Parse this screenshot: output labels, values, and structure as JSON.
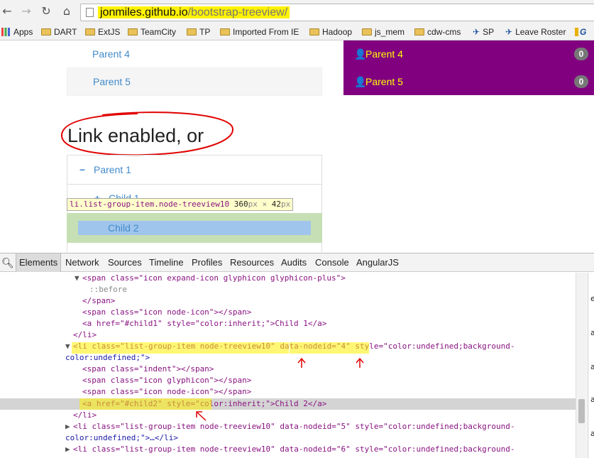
{
  "browser": {
    "url_host": "jonmiles.github.io",
    "url_path": "/bootstrap-treeview/"
  },
  "bookmarks": [
    "Apps",
    "DART",
    "ExtJS",
    "TeamCity",
    "TP",
    "Imported From IE",
    "Hadoop",
    "js_mem",
    "cdw-cms",
    "SP",
    "Leave Roster",
    "G"
  ],
  "left_tree": {
    "items": [
      "Parent 4",
      "Parent 5"
    ]
  },
  "purple_tree": {
    "items": [
      {
        "label": "Parent 4",
        "badge": "0"
      },
      {
        "label": "Parent 5",
        "badge": "0"
      }
    ]
  },
  "section_title": "Link enabled, or",
  "tree2": {
    "parent1": "Parent 1",
    "child1": "Child 1",
    "child2": "Child 2",
    "minus": "−"
  },
  "tooltip": {
    "selector": "li.list-group-item.node-treeview10",
    "width": "360",
    "height": "42",
    "unit": "px",
    "times": "×"
  },
  "devtools": {
    "tabs": [
      "Elements",
      "Network",
      "Sources",
      "Timeline",
      "Profiles",
      "Resources",
      "Audits",
      "Console",
      "AngularJS"
    ]
  },
  "dom_lines": [
    "<span class=\"icon expand-icon glyphicon glyphicon-plus\">",
    "::before",
    "</span>",
    "<span class=\"icon node-icon\"></span>",
    "<a href=\"#child1\" style=\"color:inherit;\">Child 1</a>",
    "</li>",
    "<li class=\"list-group-item node-treeview10\" data-nodeid=\"4\" style=\"color:undefined;background-",
    "color:undefined;\">",
    "<span class=\"indent\"></span>",
    "<span class=\"icon glyphicon\"></span>",
    "<span class=\"icon node-icon\"></span>",
    "<a href=\"#child2\" style=\"color:inherit;\">Child 2</a>",
    "</li>",
    "<li class=\"list-group-item node-treeview10\" data-nodeid=\"5\" style=\"color:undefined;background-",
    "color:undefined;\">…</li>",
    "<li class=\"list-group-item node-treeview10\" data-nodeid=\"6\" style=\"color:undefined;background-"
  ],
  "right_pane_chars": [
    "e",
    "a",
    "a",
    "a",
    "a"
  ],
  "colors": {
    "purple": "#800080",
    "link": "#428bca",
    "highlight": "#fff200",
    "annotation": "#e00000"
  }
}
